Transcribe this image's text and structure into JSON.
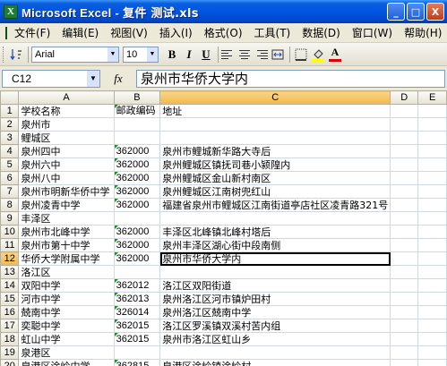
{
  "window": {
    "app_name": "Microsoft Excel",
    "separator": " - ",
    "doc_name": "复件 测试.xls",
    "buttons": {
      "minimize": "_",
      "maximize": "□",
      "close": "X"
    }
  },
  "menu": {
    "items": [
      "文件(F)",
      "编辑(E)",
      "视图(V)",
      "插入(I)",
      "格式(O)",
      "工具(T)",
      "数据(D)",
      "窗口(W)",
      "帮助(H)"
    ],
    "help_box": "",
    "right_buttons": [
      "▾",
      "_",
      "×"
    ]
  },
  "toolbar": {
    "font": "Arial",
    "size": "10",
    "bold": "B",
    "italic": "I",
    "underline": "U",
    "font_color_label": "A"
  },
  "formula": {
    "cell_ref": "C12",
    "fx": "fx",
    "value": "泉州市华侨大学内"
  },
  "sheet": {
    "columns": [
      "A",
      "B",
      "C",
      "D",
      "E"
    ],
    "rows": [
      {
        "n": "1",
        "a": "学校名称",
        "b": "邮政编码",
        "c": "地址"
      },
      {
        "n": "2",
        "a": "泉州市",
        "b": "",
        "c": ""
      },
      {
        "n": "3",
        "a": "鲤城区",
        "b": "",
        "c": ""
      },
      {
        "n": "4",
        "a": "泉州四中",
        "b": "362000",
        "c": "泉州市鲤城新华路大寺后"
      },
      {
        "n": "5",
        "a": "泉州六中",
        "b": "362000",
        "c": "泉州鲤城区镇抚司巷小颍隍内"
      },
      {
        "n": "6",
        "a": "泉州八中",
        "b": "362000",
        "c": "泉州鲤城区金山新村南区"
      },
      {
        "n": "7",
        "a": "泉州市明新华侨中学",
        "b": "362000",
        "c": "泉州鲤城区江南树兜红山"
      },
      {
        "n": "8",
        "a": "泉州凌青中学",
        "b": "362000",
        "c": "福建省泉州市鲤城区江南街道亭店社区凌青路321号"
      },
      {
        "n": "9",
        "a": "丰泽区",
        "b": "",
        "c": ""
      },
      {
        "n": "10",
        "a": "泉州市北峰中学",
        "b": "362000",
        "c": "丰泽区北峰镇北峰村塔后"
      },
      {
        "n": "11",
        "a": "泉州市第十中学",
        "b": "362000",
        "c": "泉州丰泽区湖心街中段南侧"
      },
      {
        "n": "12",
        "a": "华侨大学附属中学",
        "b": "362000",
        "c": "泉州市华侨大学内"
      },
      {
        "n": "13",
        "a": "洛江区",
        "b": "",
        "c": ""
      },
      {
        "n": "14",
        "a": "双阳中学",
        "b": "362012",
        "c": "洛江区双阳街道"
      },
      {
        "n": "15",
        "a": "河市中学",
        "b": "362013",
        "c": "泉州洛江区河市镇炉田村"
      },
      {
        "n": "16",
        "a": "兢南中学",
        "b": "326014",
        "c": "泉州洛江区兢南中学"
      },
      {
        "n": "17",
        "a": "奕聪中学",
        "b": "362015",
        "c": "洛江区罗溪镇双溪村苦内组"
      },
      {
        "n": "18",
        "a": "虹山中学",
        "b": "362015",
        "c": "泉州市洛江区虹山乡"
      },
      {
        "n": "19",
        "a": "泉港区",
        "b": "",
        "c": ""
      },
      {
        "n": "20",
        "a": "泉港区涂岭中学",
        "b": "362815",
        "c": "泉港区涂岭镇涂岭村"
      }
    ]
  }
}
